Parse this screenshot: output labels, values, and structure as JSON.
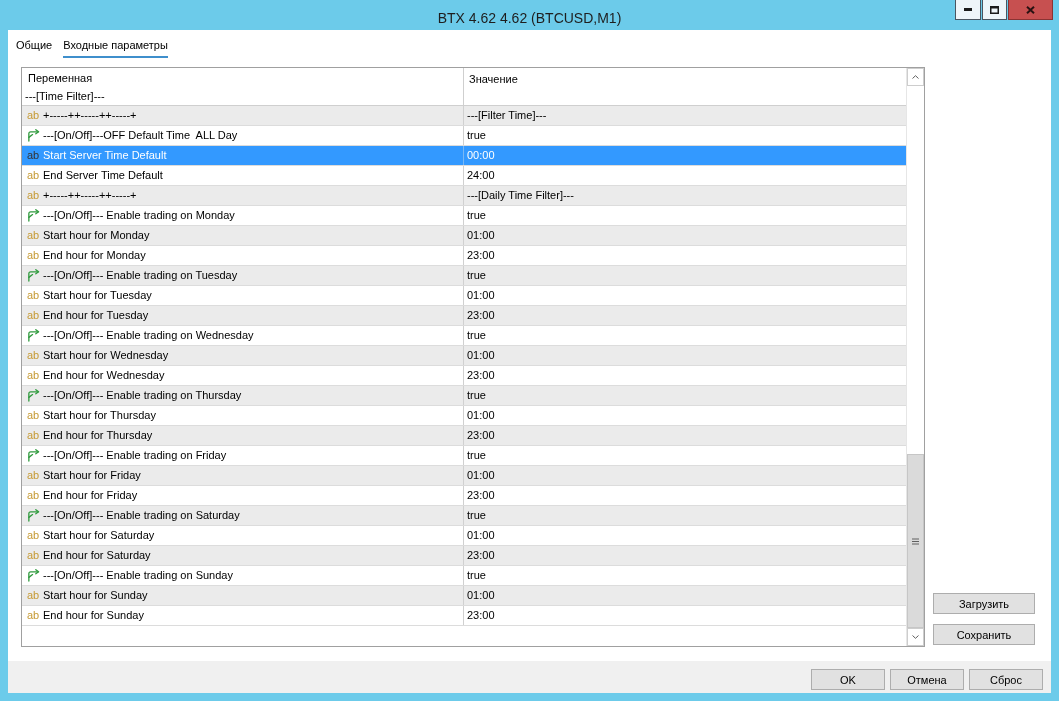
{
  "window": {
    "title": "BTX 4.62 4.62 (BTCUSD,M1)"
  },
  "tabs": [
    {
      "label": "Общие",
      "selected": false
    },
    {
      "label": "Входные параметры",
      "selected": true
    }
  ],
  "table": {
    "columns": [
      "Переменная",
      "Значение"
    ],
    "caption": "---[Time Filter]---",
    "rows": [
      {
        "kind": "string",
        "icon_text": "ab",
        "name": "+-----++-----++-----+",
        "value": "---[Filter Time]---",
        "selected": false
      },
      {
        "kind": "bool",
        "name": "---[On/Off]---OFF Default Time  ALL Day",
        "value": "true",
        "selected": false
      },
      {
        "kind": "string",
        "icon_text": "ab",
        "name": "Start Server Time Default",
        "value": "00:00",
        "selected": true
      },
      {
        "kind": "string",
        "icon_text": "ab",
        "name": "End Server Time Default",
        "value": "24:00",
        "selected": false
      },
      {
        "kind": "string",
        "icon_text": "ab",
        "name": "+-----++-----++-----+",
        "value": "---[Daily Time Filter]---",
        "selected": false
      },
      {
        "kind": "bool",
        "name": "---[On/Off]--- Enable trading on Monday",
        "value": "true",
        "selected": false
      },
      {
        "kind": "string",
        "icon_text": "ab",
        "name": "Start hour for Monday",
        "value": "01:00",
        "selected": false
      },
      {
        "kind": "string",
        "icon_text": "ab",
        "name": "End hour for Monday",
        "value": "23:00",
        "selected": false
      },
      {
        "kind": "bool",
        "name": "---[On/Off]--- Enable trading on Tuesday",
        "value": "true",
        "selected": false
      },
      {
        "kind": "string",
        "icon_text": "ab",
        "name": "Start hour for Tuesday",
        "value": "01:00",
        "selected": false
      },
      {
        "kind": "string",
        "icon_text": "ab",
        "name": "End hour for Tuesday",
        "value": "23:00",
        "selected": false
      },
      {
        "kind": "bool",
        "name": "---[On/Off]--- Enable trading on Wednesday",
        "value": "true",
        "selected": false
      },
      {
        "kind": "string",
        "icon_text": "ab",
        "name": "Start hour for Wednesday",
        "value": "01:00",
        "selected": false
      },
      {
        "kind": "string",
        "icon_text": "ab",
        "name": "End hour for Wednesday",
        "value": "23:00",
        "selected": false
      },
      {
        "kind": "bool",
        "name": "---[On/Off]--- Enable trading on Thursday",
        "value": "true",
        "selected": false
      },
      {
        "kind": "string",
        "icon_text": "ab",
        "name": "Start hour for Thursday",
        "value": "01:00",
        "selected": false
      },
      {
        "kind": "string",
        "icon_text": "ab",
        "name": "End hour for Thursday",
        "value": "23:00",
        "selected": false
      },
      {
        "kind": "bool",
        "name": "---[On/Off]--- Enable trading on Friday",
        "value": "true",
        "selected": false
      },
      {
        "kind": "string",
        "icon_text": "ab",
        "name": "Start hour for Friday",
        "value": "01:00",
        "selected": false
      },
      {
        "kind": "string",
        "icon_text": "ab",
        "name": "End hour for Friday",
        "value": "23:00",
        "selected": false
      },
      {
        "kind": "bool",
        "name": "---[On/Off]--- Enable trading on Saturday",
        "value": "true",
        "selected": false
      },
      {
        "kind": "string",
        "icon_text": "ab",
        "name": "Start hour for Saturday",
        "value": "01:00",
        "selected": false
      },
      {
        "kind": "string",
        "icon_text": "ab",
        "name": "End hour for Saturday",
        "value": "23:00",
        "selected": false
      },
      {
        "kind": "bool",
        "name": "---[On/Off]--- Enable trading on Sunday",
        "value": "true",
        "selected": false
      },
      {
        "kind": "string",
        "icon_text": "ab",
        "name": "Start hour for Sunday",
        "value": "01:00",
        "selected": false
      },
      {
        "kind": "string",
        "icon_text": "ab",
        "name": "End hour for Sunday",
        "value": "23:00",
        "selected": false
      }
    ]
  },
  "side_buttons": [
    "Загрузить",
    "Сохранить"
  ],
  "buttons": [
    "OK",
    "Отмена",
    "Сброс"
  ]
}
